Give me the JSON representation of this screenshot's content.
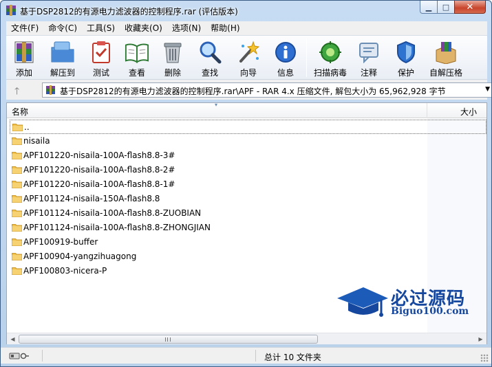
{
  "window": {
    "title": "基于DSP2812的有源电力滤波器的控制程序.rar (评估版本)",
    "min_glyph": "▁",
    "max_glyph": "□",
    "close_glyph": "✕"
  },
  "menu": [
    "文件(F)",
    "命令(C)",
    "工具(S)",
    "收藏夹(O)",
    "选项(N)",
    "帮助(H)"
  ],
  "toolbar": {
    "buttons": [
      {
        "label": "添加",
        "icon": "add-archive-icon"
      },
      {
        "label": "解压到",
        "icon": "extract-to-icon"
      },
      {
        "label": "测试",
        "icon": "test-icon"
      },
      {
        "label": "查看",
        "icon": "view-book-icon"
      },
      {
        "label": "删除",
        "icon": "delete-trash-icon"
      },
      {
        "label": "查找",
        "icon": "find-magnifier-icon"
      },
      {
        "label": "向导",
        "icon": "wizard-wand-icon"
      },
      {
        "label": "信息",
        "icon": "info-icon"
      },
      {
        "label": "扫描病毒",
        "icon": "virus-scan-icon"
      },
      {
        "label": "注释",
        "icon": "comment-icon"
      },
      {
        "label": "保护",
        "icon": "protect-shield-icon"
      },
      {
        "label": "自解压格",
        "icon": "sfx-box-icon"
      }
    ]
  },
  "address": {
    "up_glyph": "🡑",
    "path": "基于DSP2812的有源电力滤波器的控制程序.rar\\APF - RAR 4.x 压缩文件, 解包大小为 65,962,928 字节",
    "dropdown_glyph": "▼"
  },
  "columns": {
    "name": "名称",
    "size": "大小"
  },
  "files": [
    "..",
    "nisaila",
    "APF101220-nisaila-100A-flash8.8-3#",
    "APF101220-nisaila-100A-flash8.8-2#",
    "APF101220-nisaila-100A-flash8.8-1#",
    "APF101124-nisaila-150A-flash8.8",
    "APF101124-nisaila-100A-flash8.8-ZUOBIAN",
    "APF101124-nisaila-100A-flash8.8-ZHONGJIAN",
    "APF100919-buffer",
    "APF100904-yangzihuagong",
    "APF100803-nicera-P"
  ],
  "watermark": {
    "title": "必过源码",
    "url": "Biguo100.com"
  },
  "scroll": {
    "left_glyph": "◀",
    "right_glyph": "▶"
  },
  "status": {
    "summary": "总计 10 文件夹"
  },
  "colors": {
    "folder": "#f2c24f",
    "accent": "#15479e"
  }
}
